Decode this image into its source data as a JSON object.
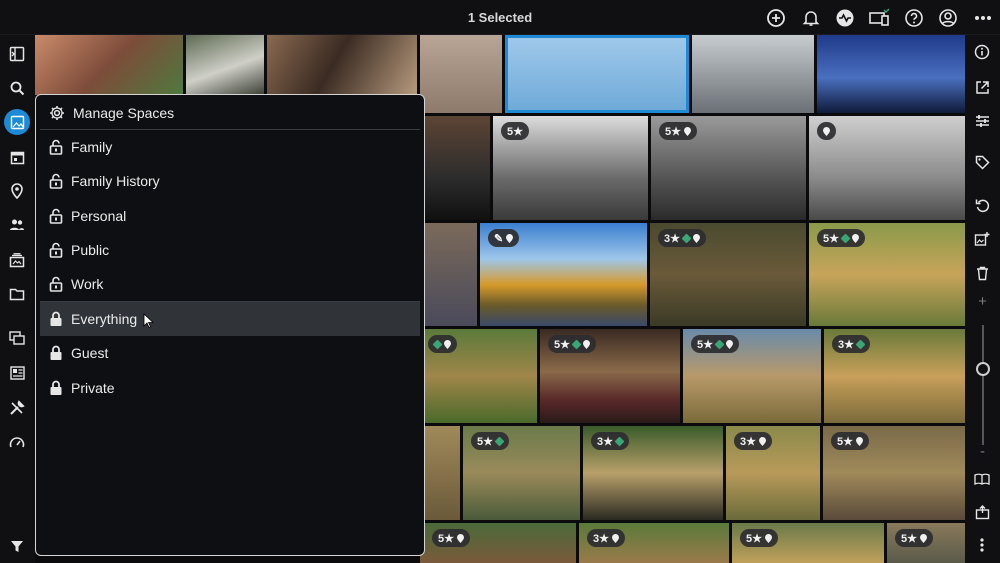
{
  "topbar": {
    "title": "1 Selected",
    "icons": [
      "add-circle-icon",
      "bell-icon",
      "activity-icon",
      "devices-icon",
      "help-icon",
      "account-icon",
      "more-horizontal-icon"
    ]
  },
  "leftnav": {
    "icons": [
      "sidebar-toggle-icon",
      "search-icon",
      "photos-icon",
      "calendar-icon",
      "location-icon",
      "people-icon",
      "albums-icon",
      "folder-icon",
      "stack-icon",
      "dashboard-icon",
      "tools-icon",
      "gauge-icon",
      "filter-icon"
    ],
    "active": "photos-icon"
  },
  "rightbar": {
    "icons": [
      "info-icon",
      "external-link-icon",
      "adjust-icon",
      "tag-icon",
      "rotate-icon",
      "add-image-icon",
      "trash-icon",
      "zoom-in-icon",
      "zoom-out-icon",
      "book-icon",
      "export-icon",
      "more-vertical-icon"
    ],
    "zoom_level": 0.35
  },
  "spaces_menu": {
    "manage_label": "Manage Spaces",
    "unlocked": [
      {
        "label": "Family"
      },
      {
        "label": "Family History"
      },
      {
        "label": "Personal"
      },
      {
        "label": "Public"
      },
      {
        "label": "Work"
      }
    ],
    "locked": [
      {
        "label": "Everything",
        "highlighted": true
      },
      {
        "label": "Guest"
      },
      {
        "label": "Private"
      }
    ]
  },
  "badges": {
    "b1": {
      "rating": "5★",
      "tag": false,
      "pin": false
    },
    "b2": {
      "rating": "5★",
      "tag": false,
      "pin": true
    },
    "b3": {
      "rating": "",
      "tag": false,
      "pin": true
    },
    "b4": {
      "rating": "✎",
      "tag": false,
      "pin": true
    },
    "b5": {
      "rating": "3★",
      "tag": true,
      "pin": true
    },
    "b6": {
      "rating": "5★",
      "tag": true,
      "pin": true
    },
    "b7": {
      "rating": "",
      "tag": true,
      "pin": true
    },
    "b8": {
      "rating": "5★",
      "tag": true,
      "pin": true
    },
    "b9": {
      "rating": "5★",
      "tag": true,
      "pin": true
    },
    "b10": {
      "rating": "3★",
      "tag": true,
      "pin": false
    },
    "b11": {
      "rating": "5★",
      "tag": true,
      "pin": false
    },
    "b12": {
      "rating": "3★",
      "tag": true,
      "pin": false
    },
    "b13": {
      "rating": "3★",
      "tag": false,
      "pin": true
    },
    "b14": {
      "rating": "5★",
      "tag": false,
      "pin": true
    },
    "b15": {
      "rating": "5★",
      "tag": false,
      "pin": true
    },
    "b16": {
      "rating": "3★",
      "tag": false,
      "pin": true
    },
    "b17": {
      "rating": "5★",
      "tag": false,
      "pin": true
    },
    "b18": {
      "rating": "5★",
      "tag": false,
      "pin": true
    }
  },
  "colors": {
    "accent": "#1e8ad6",
    "tag_green": "#3aa677"
  }
}
